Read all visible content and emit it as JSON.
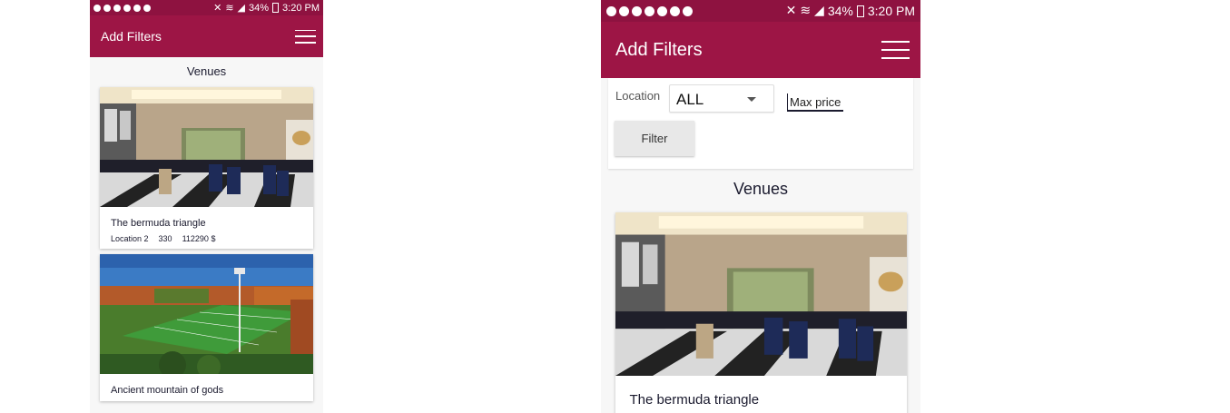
{
  "status_bar": {
    "battery": "34%",
    "time": "3:20 PM"
  },
  "app_bar": {
    "title": "Add Filters"
  },
  "venues_heading": "Venues",
  "filters": {
    "location_label": "Location",
    "location_selected": "ALL",
    "max_price_placeholder": "Max price",
    "filter_button": "Filter"
  },
  "venues": [
    {
      "name": "The bermuda triangle",
      "location": "Location 2",
      "capacity": "330",
      "price": "112290 $"
    },
    {
      "name": "Ancient mountain of gods"
    }
  ],
  "colors": {
    "status_bar": "#8e1240",
    "app_bar": "#9d1545"
  }
}
